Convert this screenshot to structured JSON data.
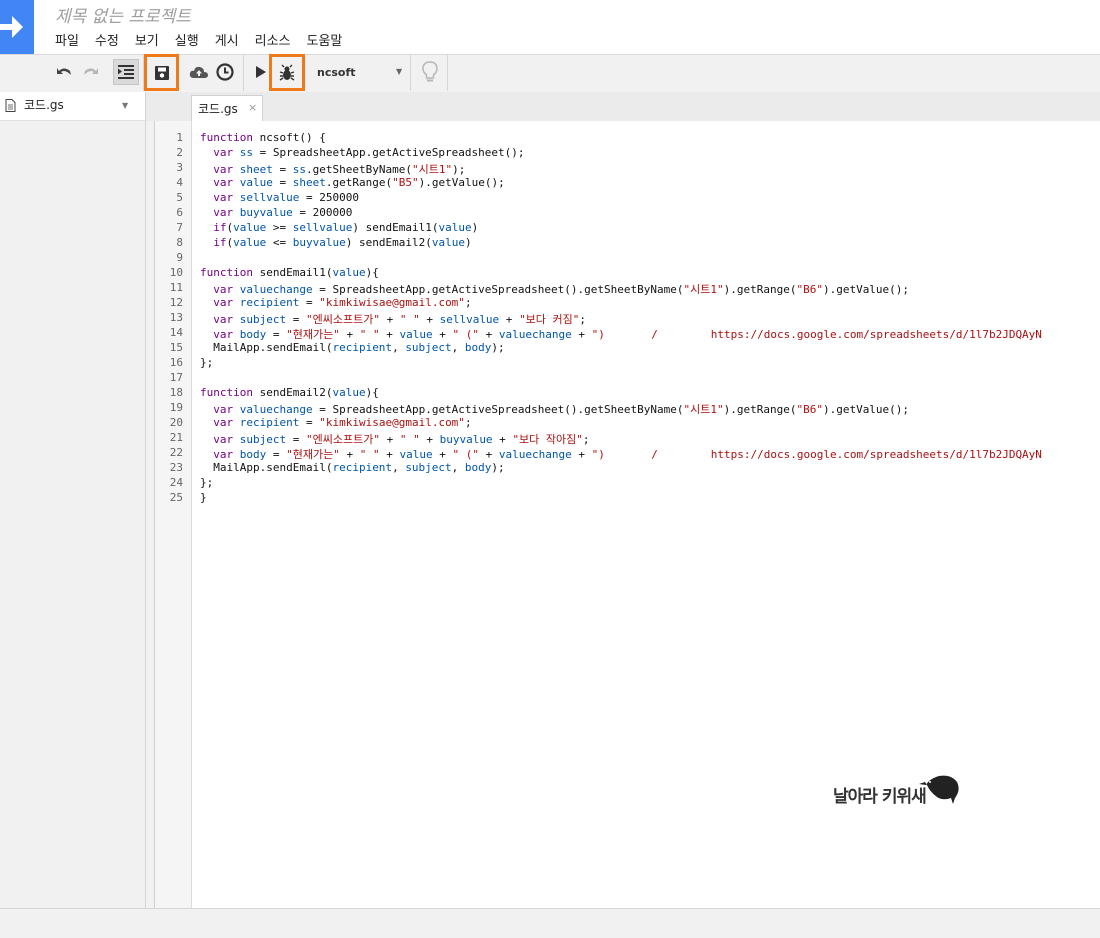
{
  "header": {
    "project_title": "제목 없는 프로젝트",
    "menu": [
      "파일",
      "수정",
      "보기",
      "실행",
      "게시",
      "리소스",
      "도움말"
    ]
  },
  "toolbar": {
    "function_name": "ncsoft",
    "icons": [
      "undo-icon",
      "redo-icon",
      "indent-icon",
      "save-icon",
      "cloud-icon",
      "clock-icon",
      "run-icon",
      "debug-icon",
      "lightbulb-icon"
    ]
  },
  "sidebar": {
    "file_name": "코드.gs"
  },
  "editor": {
    "tab_label": "코드.gs",
    "tab_close": "×",
    "line_numbers": [
      "1",
      "2",
      "3",
      "4",
      "5",
      "6",
      "7",
      "8",
      "9",
      "10",
      "11",
      "12",
      "13",
      "14",
      "15",
      "16",
      "17",
      "18",
      "19",
      "20",
      "21",
      "22",
      "23",
      "24",
      "25"
    ],
    "lines": [
      "function ncsoft() {",
      "  var ss = SpreadsheetApp.getActiveSpreadsheet();",
      "  var sheet = ss.getSheetByName(\"시트1\");",
      "  var value = sheet.getRange(\"B5\").getValue();",
      "  var sellvalue = 250000",
      "  var buyvalue = 200000",
      "  if(value >= sellvalue) sendEmail1(value)",
      "  if(value <= buyvalue) sendEmail2(value)",
      "",
      "function sendEmail1(value){",
      "  var valuechange = SpreadsheetApp.getActiveSpreadsheet().getSheetByName(\"시트1\").getRange(\"B6\").getValue();",
      "  var recipient = \"kimkiwisae@gmail.com\";",
      "  var subject = \"엔씨소프트가\" + \" \" + sellvalue + \"보다 커짐\";",
      "  var body = \"현재가는\" + \" \" + value + \" (\" + valuechange + \")       /        https://docs.google.com/spreadsheets/d/1l7b2JDQAyN",
      "  MailApp.sendEmail(recipient, subject, body);",
      "};",
      "",
      "function sendEmail2(value){",
      "  var valuechange = SpreadsheetApp.getActiveSpreadsheet().getSheetByName(\"시트1\").getRange(\"B6\").getValue();",
      "  var recipient = \"kimkiwisae@gmail.com\";",
      "  var subject = \"엔씨소프트가\" + \" \" + buyvalue + \"보다 작아짐\";",
      "  var body = \"현재가는\" + \" \" + value + \" (\" + valuechange + \")       /        https://docs.google.com/spreadsheets/d/1l7b2JDQAyN",
      "  MailApp.sendEmail(recipient, subject, body);",
      "};",
      "}"
    ]
  },
  "watermark": {
    "text": "날아라 키위새"
  },
  "colors": {
    "logo": "#4285f4",
    "highlight": "#ef7a1a",
    "keyword": "#770088",
    "variable": "#0055aa",
    "string": "#aa1111"
  }
}
